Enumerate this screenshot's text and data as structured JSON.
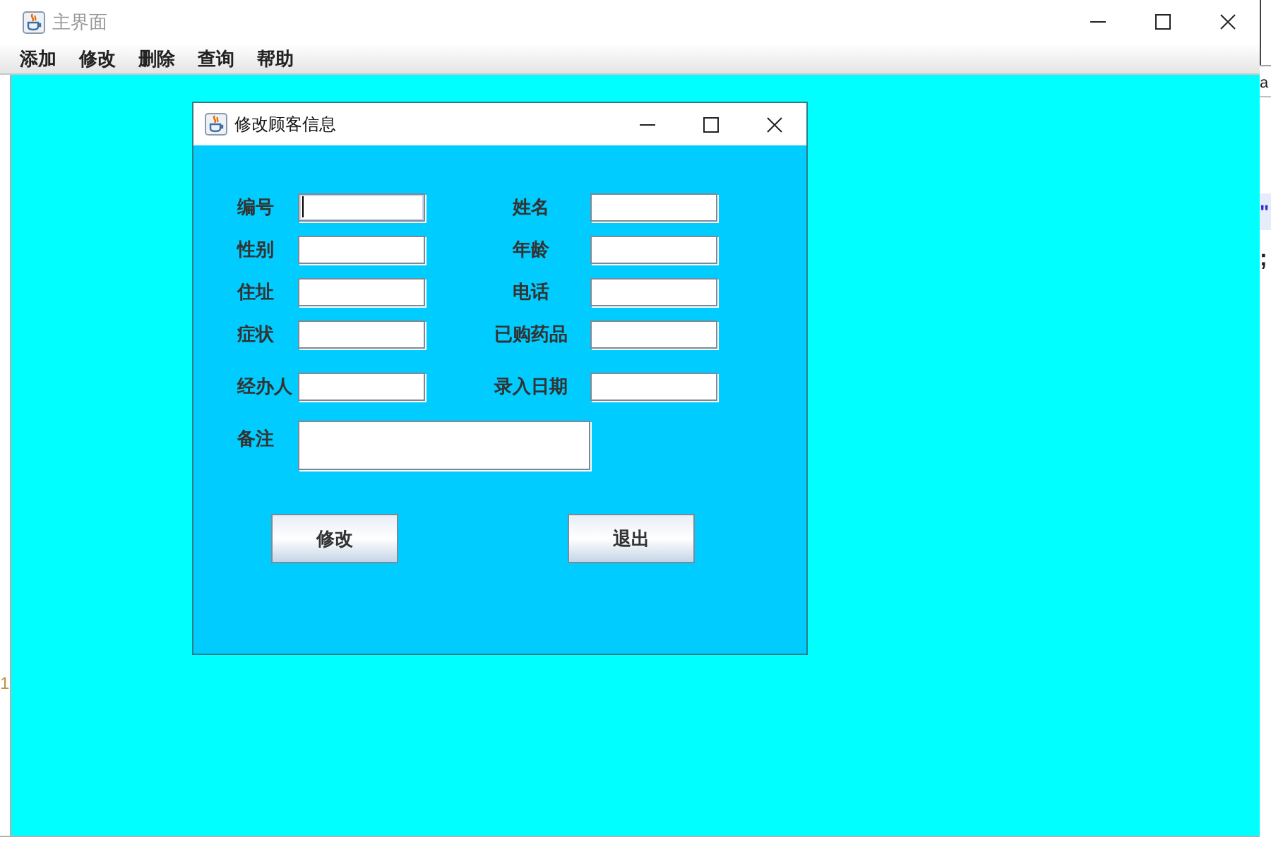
{
  "main_window": {
    "title": "主界面",
    "menu": [
      "添加",
      "修改",
      "删除",
      "查询",
      "帮助"
    ]
  },
  "dialog": {
    "title": "修改顾客信息",
    "rows": [
      [
        {
          "label": "编号",
          "focused": true
        },
        {
          "label": "姓名",
          "focused": false
        }
      ],
      [
        {
          "label": "性别",
          "focused": false
        },
        {
          "label": "年龄",
          "focused": false
        }
      ],
      [
        {
          "label": "住址",
          "focused": false
        },
        {
          "label": "电话",
          "focused": false
        }
      ],
      [
        {
          "label": "症状",
          "focused": false
        },
        {
          "label": "已购药品",
          "focused": false
        }
      ],
      [
        {
          "label": "经办人",
          "focused": false
        },
        {
          "label": "录入日期",
          "focused": false
        }
      ]
    ],
    "remark": {
      "label": "备注",
      "focused": false
    },
    "buttons": [
      "修改",
      "退出"
    ]
  },
  "background": {
    "left_text": "1",
    "right_texts": [
      "a",
      "\"",
      ";"
    ]
  }
}
